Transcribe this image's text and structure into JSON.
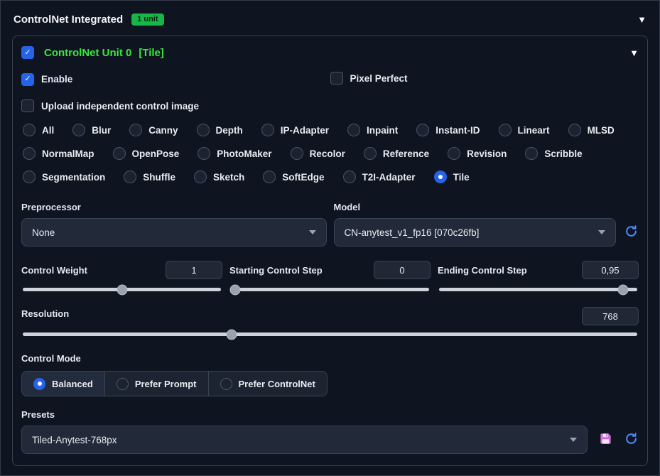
{
  "header": {
    "title": "ControlNet Integrated",
    "badge": "1 unit"
  },
  "unit": {
    "title": "ControlNet Unit 0",
    "title_suffix": "[Tile]",
    "enable_label": "Enable",
    "pixel_perfect_label": "Pixel Perfect",
    "upload_label": "Upload independent control image"
  },
  "control_types": {
    "options": [
      "All",
      "Blur",
      "Canny",
      "Depth",
      "IP-Adapter",
      "Inpaint",
      "Instant-ID",
      "Lineart",
      "MLSD",
      "NormalMap",
      "OpenPose",
      "PhotoMaker",
      "Recolor",
      "Reference",
      "Revision",
      "Scribble",
      "Segmentation",
      "Shuffle",
      "Sketch",
      "SoftEdge",
      "T2I-Adapter",
      "Tile"
    ],
    "selected": "Tile"
  },
  "preprocessor": {
    "label": "Preprocessor",
    "value": "None"
  },
  "model": {
    "label": "Model",
    "value": "CN-anytest_v1_fp16 [070c26fb]"
  },
  "sliders": {
    "control_weight": {
      "label": "Control Weight",
      "value": "1",
      "percent": 50
    },
    "starting_step": {
      "label": "Starting Control Step",
      "value": "0",
      "percent": 2
    },
    "ending_step": {
      "label": "Ending Control Step",
      "value": "0,95",
      "percent": 93
    },
    "resolution": {
      "label": "Resolution",
      "value": "768",
      "percent": 34
    }
  },
  "control_mode": {
    "label": "Control Mode",
    "options": [
      "Balanced",
      "Prefer Prompt",
      "Prefer ControlNet"
    ],
    "selected": "Balanced"
  },
  "presets": {
    "label": "Presets",
    "value": "Tiled-Anytest-768px"
  },
  "icons": {
    "collapse": "▼",
    "refresh": "refresh-icon",
    "save": "save-icon"
  },
  "colors": {
    "accent_blue": "#2563eb",
    "unit_title_green": "#3ce73c",
    "badge_green": "#18b549",
    "refresh_icon_blue": "#4a8cf7",
    "save_icon_pink": "#d16ee0",
    "slider_track_gray": "#cfd4dc",
    "background": "#0e1420"
  }
}
